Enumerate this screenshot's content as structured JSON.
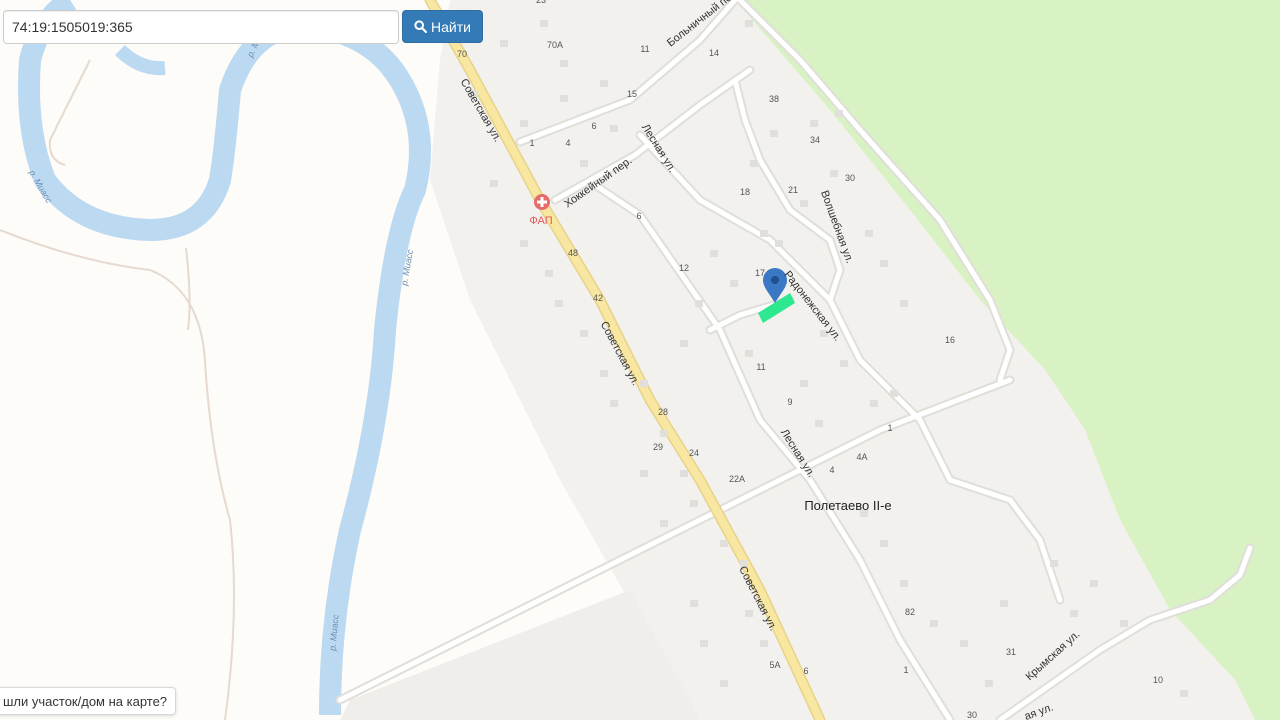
{
  "search": {
    "value": "74:19:1505019:365",
    "button_label": "Найти",
    "icon": "search-icon"
  },
  "hint": {
    "text": "шли участок/дом на карте?"
  },
  "map": {
    "village": "Полетаево II-е",
    "poi_label": "ФАП",
    "rivers": [
      "р. Миасс",
      "р. Миасс",
      "р. Миасс",
      "р. М"
    ],
    "streets": {
      "sovetskaya": "Советская ул.",
      "lesnaya": "Лесная ул.",
      "hokkeyny": "Хоккейный пер.",
      "bolnichny": "Больничный пер.",
      "volshebnaya": "Волшебная ул.",
      "radonezhskaya": "Радонежская ул.",
      "krymskaya": "Крымская ул.",
      "partial": "ая ул."
    },
    "house_numbers": [
      "23",
      "70",
      "70А",
      "11",
      "14",
      "15",
      "6",
      "4",
      "1",
      "38",
      "34",
      "30",
      "18",
      "21",
      "6",
      "48",
      "12",
      "17",
      "42",
      "16",
      "11",
      "9",
      "28",
      "29",
      "24",
      "1",
      "4",
      "4А",
      "22А",
      "82",
      "5А",
      "6",
      "1",
      "31",
      "10",
      "30"
    ],
    "colors": {
      "water": "#bcd9f2",
      "forest": "#d9f2c4",
      "road": "#f8e7a0",
      "parcel": "#2ee88f",
      "marker": "#3a78c3"
    }
  }
}
